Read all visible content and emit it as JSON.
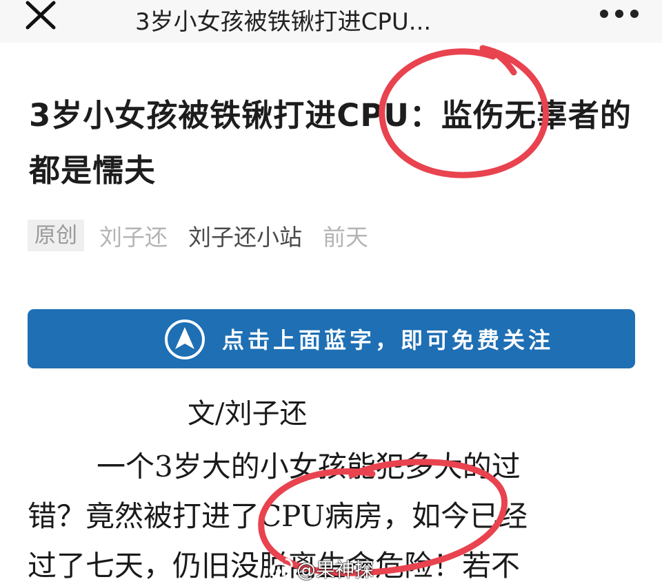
{
  "nav": {
    "title": "3岁小女孩被铁锹打进CPU..."
  },
  "article": {
    "title": "3岁小女孩被铁锹打进CPU：监伤无辜者的都是懦夫",
    "original_badge": "原创",
    "author": "刘子还",
    "account": "刘子还小站",
    "date": "前天"
  },
  "follow_banner": {
    "text": "点击上面蓝字，即可免费关注"
  },
  "body": {
    "byline": "文/刘子还",
    "lines": [
      "一个3岁大的小女孩能犯多大的过",
      "错？竟然被打进了CPU病房，如今已经",
      "过了七天，仍旧没脱离生命危险！若不"
    ]
  },
  "watermark": {
    "text": "@果神探"
  },
  "colors": {
    "banner": "#1e6fb4",
    "annotation": "#e8434f",
    "topbar": "#f7f7f7"
  }
}
